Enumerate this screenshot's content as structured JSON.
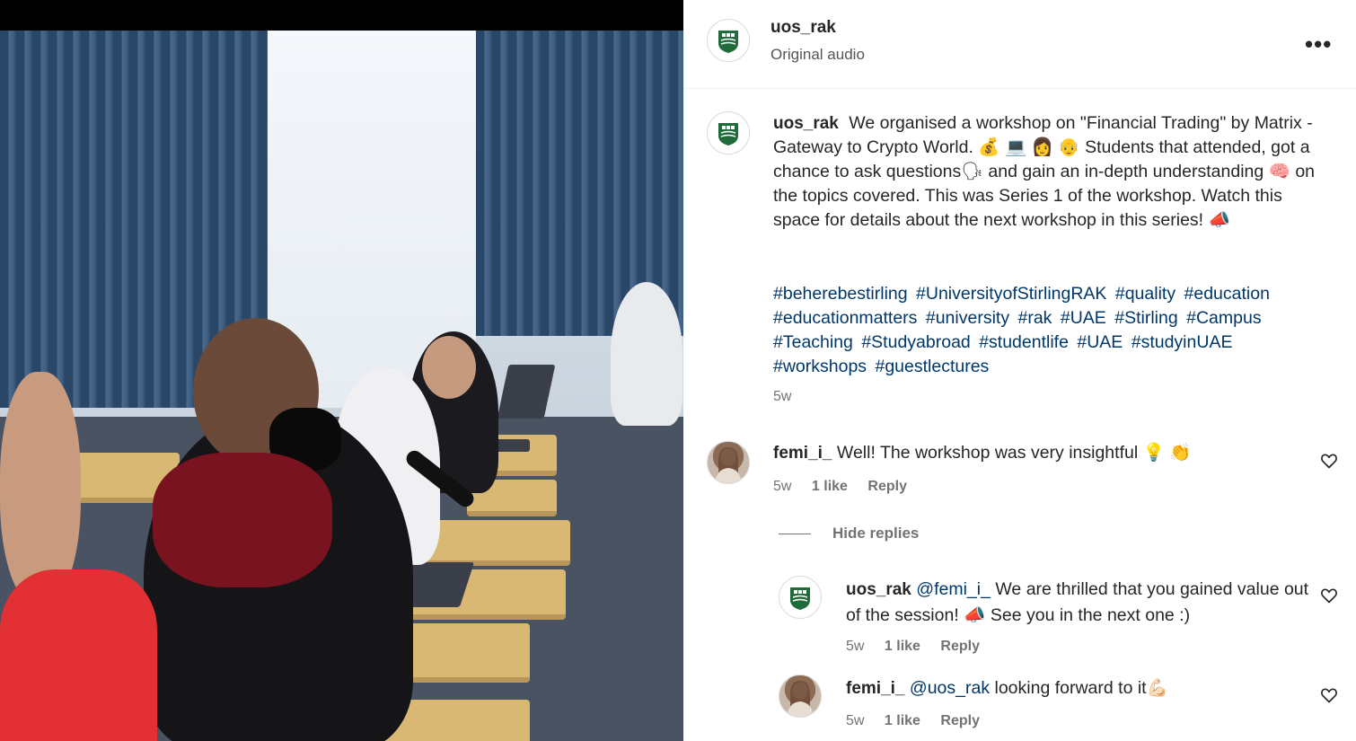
{
  "post": {
    "author": "uos_rak",
    "audio": "Original audio",
    "more_label": "•••",
    "caption_text": "We organised a workshop on \"Financial Trading\" by Matrix - Gateway to Crypto World. 💰 💻 👩 👴 Students that attended, got a chance to ask questions🗣 and gain an in-depth understanding 🧠 on the topics covered. This was Series 1 of the workshop. Watch this space for details about the next workshop in this series! 📣",
    "hashtags": [
      "#beherebestirling",
      "#UniversityofStirlingRAK",
      "#quality",
      "#education",
      "#educationmatters",
      "#university",
      "#rak",
      "#UAE",
      "#Stirling",
      "#Campus",
      "#Teaching",
      "#Studyabroad",
      "#studentlife",
      "#UAE",
      "#studyinUAE",
      "#workshops",
      "#guestlectures"
    ],
    "time": "5w"
  },
  "comments": [
    {
      "author": "femi_i_",
      "text": "Well! The workshop was very insightful 💡 👏",
      "time": "5w",
      "likes": "1 like",
      "reply_label": "Reply"
    }
  ],
  "hide_replies_label": "Hide replies",
  "replies": [
    {
      "author": "uos_rak",
      "mention": "@femi_i_",
      "text": "We are thrilled that you gained value out of the session! 📣 See you in the next one :)",
      "time": "5w",
      "likes": "1 like",
      "reply_label": "Reply"
    },
    {
      "author": "femi_i_",
      "mention": "@uos_rak",
      "text": "looking forward to it💪🏻",
      "time": "5w",
      "likes": "1 like",
      "reply_label": "Reply"
    }
  ],
  "colors": {
    "link": "#00376b",
    "muted": "#737373",
    "text": "#262626",
    "logo_green": "#1f6b3a"
  },
  "icons": {
    "brand_avatar": "university-crest-icon",
    "user_avatar": "profile-photo",
    "like": "heart-icon"
  }
}
